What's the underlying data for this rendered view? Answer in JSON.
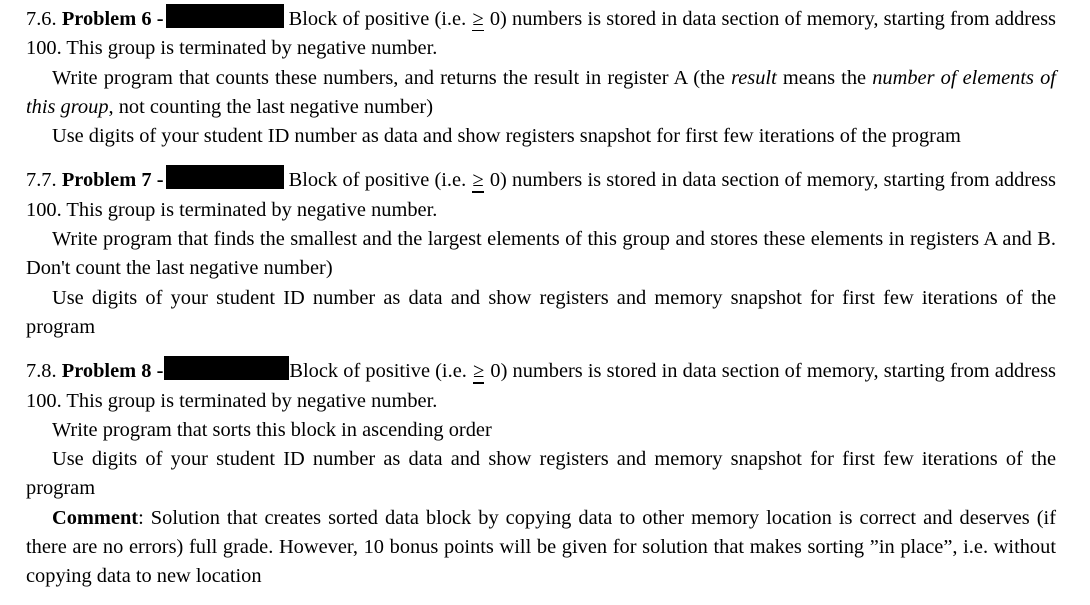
{
  "document": {
    "type": "assignment-problem-set",
    "background_color": "#ffffff",
    "text_color": "#000000",
    "redaction_color": "#000000"
  },
  "problems": [
    {
      "number": "7.6.",
      "title": "Problem 6 -",
      "redacted": true,
      "intro_a": "Block of positive (i.e.",
      "geq": "≥",
      "intro_b": "0) numbers is stored in data section of memory, starting from address 100. This group is terminated by negative number.",
      "body_1_a": "Write program that counts these numbers, and returns the result in register A (the",
      "body_1_em": "result",
      "body_1_b": "means the",
      "body_1_em2": "number of elements of this group",
      "body_1_c": ", not counting the last negative number)",
      "body_2": "Use digits of your student ID number as data and show registers snapshot for first few iterations of the program"
    },
    {
      "number": "7.7.",
      "title": "Problem 7 -",
      "redacted": true,
      "intro_a": "Block of positive (i.e.",
      "geq": "≥",
      "intro_b": "0) numbers is stored in data section of memory, starting from address 100. This group is terminated by negative number.",
      "body_1": "Write program that finds the smallest and the largest elements of this group and stores these elements in registers A and B. Don't count the last negative number)",
      "body_2": "Use digits of your student ID number as data and show registers and memory snapshot for first few iterations of the program"
    },
    {
      "number": "7.8.",
      "title": "Problem 8 -",
      "redacted": true,
      "intro_a": "Block of positive (i.e.",
      "geq": "≥",
      "intro_b": "0) numbers is stored in data section of memory, starting from address 100. This group is terminated by negative number.",
      "body_1": "Write program that sorts this block in ascending order",
      "body_2": "Use digits of your student ID number as data and show registers and memory snapshot for first few iterations of the program",
      "comment_label": "Comment",
      "comment_sep": ":",
      "comment_text": "Solution that creates sorted data block by copying data to other memory location is correct and deserves (if there are no errors) full grade. However, 10 bonus points will be given for solution that makes sorting ”in place”, i.e. without copying data to new location"
    }
  ]
}
